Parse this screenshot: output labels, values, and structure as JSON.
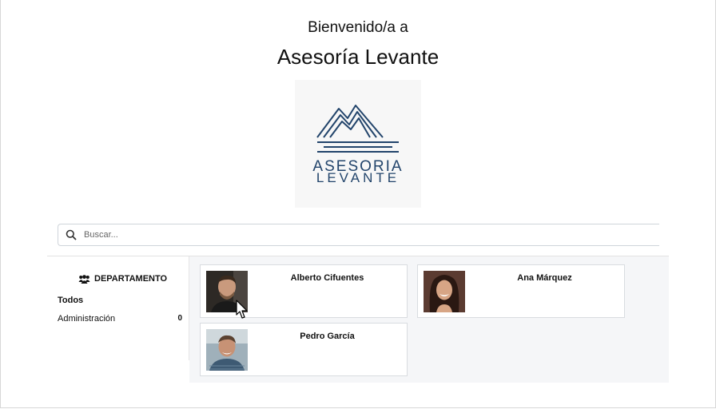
{
  "header": {
    "welcome": "Bienvenido/a a",
    "company": "Asesoría Levante",
    "logo_text_line1": "ASESORIA",
    "logo_text_line2": "LEVANTE"
  },
  "search": {
    "placeholder": "Buscar..."
  },
  "sidebar": {
    "heading": "DEPARTAMENTO",
    "all_label": "Todos",
    "items": [
      {
        "label": "Administración",
        "count": "0"
      }
    ]
  },
  "employees": [
    {
      "name": "Alberto Cifuentes"
    },
    {
      "name": "Ana Márquez"
    },
    {
      "name": "Pedro García"
    }
  ],
  "colors": {
    "logo": "#22446b",
    "content_bg": "#f5f6f8"
  }
}
